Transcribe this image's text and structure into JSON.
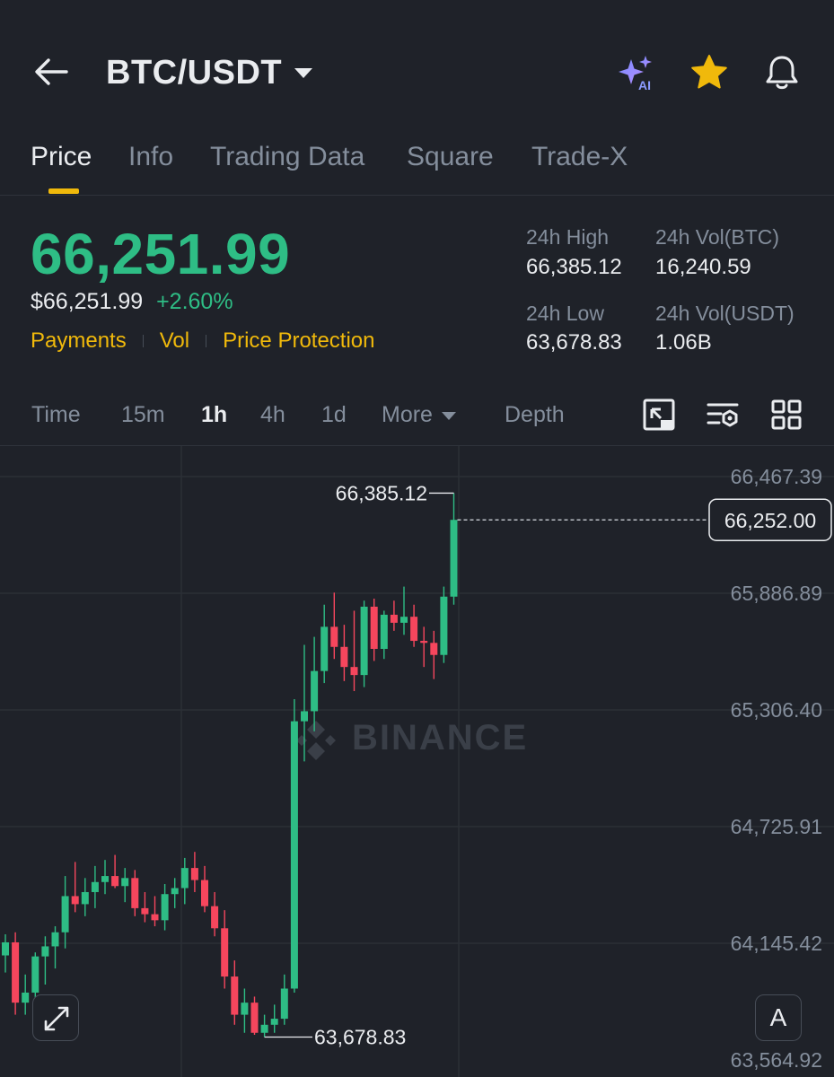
{
  "header": {
    "pair": "BTC/USDT",
    "icons": [
      "back-arrow-icon",
      "ai-sparkle-icon",
      "star-icon",
      "bell-icon"
    ],
    "ai_badge": "AI"
  },
  "tabs": [
    {
      "label": "Price",
      "active": true
    },
    {
      "label": "Info",
      "active": false
    },
    {
      "label": "Trading Data",
      "active": false
    },
    {
      "label": "Square",
      "active": false
    },
    {
      "label": "Trade-X",
      "active": false
    }
  ],
  "price": {
    "last": "66,251.99",
    "usd": "$66,251.99",
    "change": "+2.60%",
    "links": [
      "Payments",
      "Vol",
      "Price Protection"
    ]
  },
  "stats": {
    "high_label": "24h High",
    "high_value": "66,385.12",
    "vol_btc_label": "24h Vol(BTC)",
    "vol_btc_value": "16,240.59",
    "low_label": "24h Low",
    "low_value": "63,678.83",
    "vol_usdt_label": "24h Vol(USDT)",
    "vol_usdt_value": "1.06B"
  },
  "timeframes": {
    "items": [
      "Time",
      "15m",
      "1h",
      "4h",
      "1d"
    ],
    "active": "1h",
    "more_label": "More",
    "depth_label": "Depth"
  },
  "colors": {
    "up": "#2ebd85",
    "down": "#f6465d",
    "accent": "#f0b90b",
    "background": "#1f2229"
  },
  "chart_data": {
    "type": "candlestick",
    "y_ticks": [
      "66,467.39",
      "65,886.89",
      "65,306.40",
      "64,725.91",
      "64,145.42",
      "63,564.92"
    ],
    "ylim": [
      63564.92,
      66467.39
    ],
    "current_price_label": "66,252.00",
    "current_price": 66252.0,
    "high_marker": {
      "label": "66,385.12",
      "value": 66385.12
    },
    "low_marker": {
      "label": "63,678.83",
      "value": 63678.83
    },
    "watermark": "BINANCE",
    "grid": true,
    "candles": [
      {
        "o": 64085,
        "h": 64190,
        "l": 64000,
        "c": 64150
      },
      {
        "o": 64150,
        "h": 64200,
        "l": 63790,
        "c": 63850
      },
      {
        "o": 63850,
        "h": 63990,
        "l": 63790,
        "c": 63900
      },
      {
        "o": 63900,
        "h": 64100,
        "l": 63860,
        "c": 64080
      },
      {
        "o": 64080,
        "h": 64180,
        "l": 63940,
        "c": 64130
      },
      {
        "o": 64130,
        "h": 64230,
        "l": 64020,
        "c": 64200
      },
      {
        "o": 64200,
        "h": 64480,
        "l": 64120,
        "c": 64380
      },
      {
        "o": 64380,
        "h": 64550,
        "l": 64300,
        "c": 64340
      },
      {
        "o": 64340,
        "h": 64470,
        "l": 64280,
        "c": 64400
      },
      {
        "o": 64400,
        "h": 64530,
        "l": 64320,
        "c": 64450
      },
      {
        "o": 64450,
        "h": 64560,
        "l": 64390,
        "c": 64480
      },
      {
        "o": 64480,
        "h": 64585,
        "l": 64420,
        "c": 64430
      },
      {
        "o": 64430,
        "h": 64520,
        "l": 64350,
        "c": 64470
      },
      {
        "o": 64470,
        "h": 64510,
        "l": 64280,
        "c": 64320
      },
      {
        "o": 64320,
        "h": 64400,
        "l": 64250,
        "c": 64290
      },
      {
        "o": 64290,
        "h": 64380,
        "l": 64230,
        "c": 64260
      },
      {
        "o": 64260,
        "h": 64440,
        "l": 64210,
        "c": 64390
      },
      {
        "o": 64390,
        "h": 64470,
        "l": 64320,
        "c": 64420
      },
      {
        "o": 64420,
        "h": 64570,
        "l": 64340,
        "c": 64520
      },
      {
        "o": 64520,
        "h": 64600,
        "l": 64400,
        "c": 64460
      },
      {
        "o": 64460,
        "h": 64530,
        "l": 64300,
        "c": 64330
      },
      {
        "o": 64330,
        "h": 64400,
        "l": 64180,
        "c": 64220
      },
      {
        "o": 64220,
        "h": 64310,
        "l": 63920,
        "c": 63980
      },
      {
        "o": 63980,
        "h": 64060,
        "l": 63740,
        "c": 63790
      },
      {
        "o": 63790,
        "h": 63920,
        "l": 63700,
        "c": 63850
      },
      {
        "o": 63850,
        "h": 63880,
        "l": 63690,
        "c": 63700
      },
      {
        "o": 63700,
        "h": 63790,
        "l": 63679,
        "c": 63740
      },
      {
        "o": 63740,
        "h": 63840,
        "l": 63700,
        "c": 63770
      },
      {
        "o": 63770,
        "h": 63990,
        "l": 63740,
        "c": 63920
      },
      {
        "o": 63920,
        "h": 65360,
        "l": 63900,
        "c": 65250
      },
      {
        "o": 65250,
        "h": 65630,
        "l": 65050,
        "c": 65300
      },
      {
        "o": 65300,
        "h": 65670,
        "l": 65200,
        "c": 65500
      },
      {
        "o": 65500,
        "h": 65830,
        "l": 65440,
        "c": 65720
      },
      {
        "o": 65720,
        "h": 65890,
        "l": 65560,
        "c": 65620
      },
      {
        "o": 65620,
        "h": 65730,
        "l": 65450,
        "c": 65520
      },
      {
        "o": 65520,
        "h": 65800,
        "l": 65400,
        "c": 65480
      },
      {
        "o": 65480,
        "h": 65850,
        "l": 65420,
        "c": 65820
      },
      {
        "o": 65820,
        "h": 65860,
        "l": 65550,
        "c": 65610
      },
      {
        "o": 65610,
        "h": 65800,
        "l": 65560,
        "c": 65780
      },
      {
        "o": 65780,
        "h": 65850,
        "l": 65700,
        "c": 65740
      },
      {
        "o": 65740,
        "h": 65920,
        "l": 65680,
        "c": 65770
      },
      {
        "o": 65770,
        "h": 65830,
        "l": 65620,
        "c": 65650
      },
      {
        "o": 65650,
        "h": 65720,
        "l": 65520,
        "c": 65640
      },
      {
        "o": 65640,
        "h": 65700,
        "l": 65460,
        "c": 65580
      },
      {
        "o": 65580,
        "h": 65920,
        "l": 65540,
        "c": 65870
      },
      {
        "o": 65870,
        "h": 66385.12,
        "l": 65830,
        "c": 66252
      }
    ]
  }
}
